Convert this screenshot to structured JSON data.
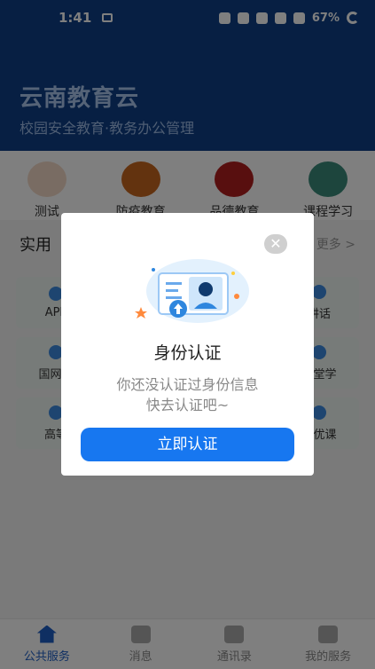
{
  "status_bar": {
    "time": "1:41",
    "battery": "67%"
  },
  "header": {
    "title": "云南教育云",
    "subtitle": "校园安全教育·教务办公管理"
  },
  "categories": [
    {
      "label": "测试",
      "icon": "people-icon",
      "color": "#d9773a"
    },
    {
      "label": "防疫教育",
      "icon": "mask-icon",
      "color": "#c7661f"
    },
    {
      "label": "品德教育",
      "icon": "morality-icon",
      "color": "#b11f1f"
    },
    {
      "label": "课程学习",
      "icon": "student-icon",
      "color": "#3a8a7b"
    }
  ],
  "section": {
    "title": "实用",
    "more": "更多 >"
  },
  "services": [
    [
      "APP",
      "",
      "",
      "讲话"
    ],
    [
      "国网系",
      "",
      "",
      "课堂学"
    ],
    [
      "高等",
      "",
      "",
      "一优课"
    ]
  ],
  "dialog": {
    "title": "身份认证",
    "message_line1": "你还没认证过身份信息",
    "message_line2": "快去认证吧~",
    "button": "立即认证",
    "close_symbol": "✕"
  },
  "tabs": [
    {
      "label": "公共服务",
      "icon": "home-icon",
      "active": true
    },
    {
      "label": "消息",
      "icon": "message-icon",
      "active": false
    },
    {
      "label": "通讯录",
      "icon": "contacts-icon",
      "active": false
    },
    {
      "label": "我的服务",
      "icon": "apps-icon",
      "active": false
    }
  ],
  "colors": {
    "header": "#0e3f86",
    "accent": "#1777f0"
  }
}
